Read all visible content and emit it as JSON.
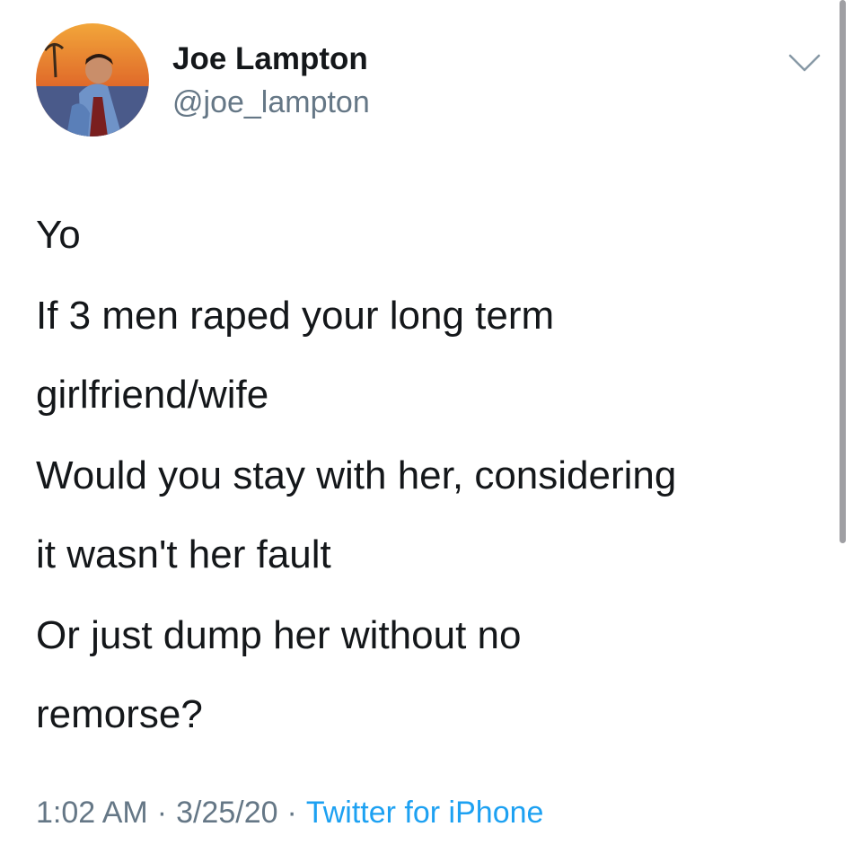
{
  "user": {
    "display_name": "Joe Lampton",
    "handle": "@joe_lampton",
    "avatar_icon": "profile-photo-avatar"
  },
  "tweet": {
    "paragraphs": [
      "Yo",
      "If 3 men raped your long term\ngirlfriend/wife",
      "Would you stay with her, considering\nit wasn't her fault",
      "Or just dump her without no\nremorse?"
    ]
  },
  "meta": {
    "time": "1:02 AM",
    "date": "3/25/20",
    "separator": "·",
    "source": "Twitter for iPhone"
  },
  "icons": {
    "menu": "chevron-down-icon"
  },
  "colors": {
    "text": "#14171a",
    "secondary": "#657786",
    "link": "#1da1f2"
  }
}
